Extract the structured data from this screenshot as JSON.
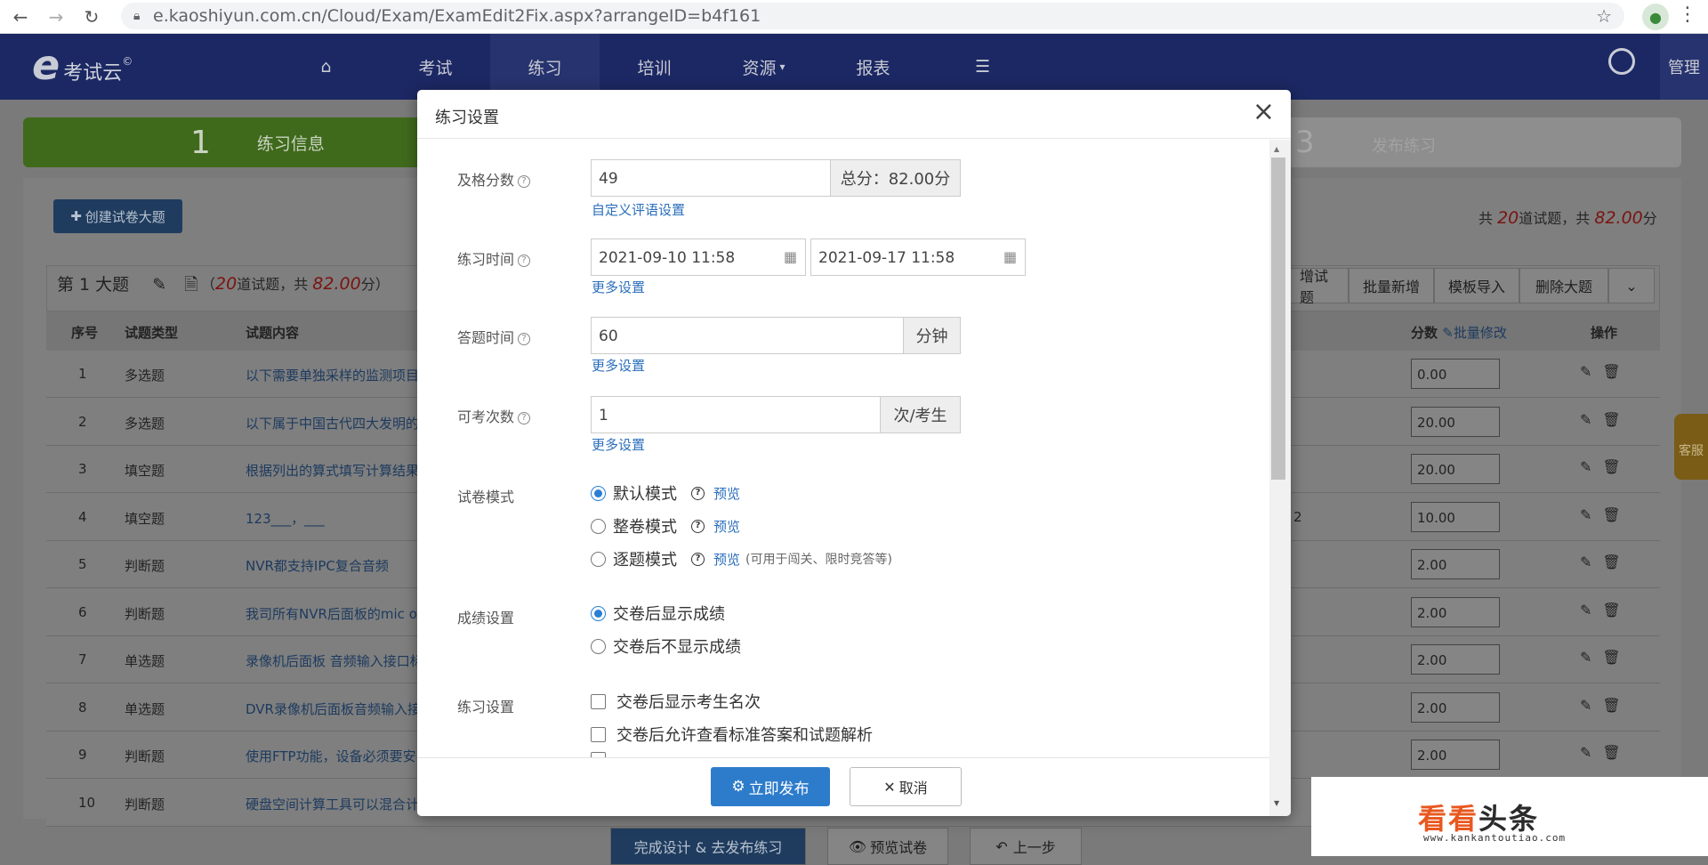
{
  "browser": {
    "url": "e.kaoshiyun.com.cn/Cloud/Exam/ExamEdit2Fix.aspx?arrangeID=b4f161"
  },
  "header": {
    "logo_text": "考试云",
    "logo_sup": "©",
    "nav": [
      "考试",
      "练习",
      "培训",
      "资源",
      "报表"
    ],
    "manage": "管理"
  },
  "steps": {
    "step1_num": "1",
    "step1_label": "练习信息",
    "step3_num": "3",
    "step3_label": "发布练习"
  },
  "toolbar": {
    "create_label": "创建试卷大题",
    "total_prefix": "共 ",
    "total_count": "20",
    "total_mid": "道试题，共 ",
    "total_score": "82.00",
    "total_suffix": "分"
  },
  "section": {
    "title": "第 1 大题",
    "info_prefix": "（",
    "info_count": "20",
    "info_mid": "道试题，共 ",
    "info_score": "82.00",
    "info_suffix": "分）",
    "buttons": [
      "增试题",
      "批量新增",
      "模板导入",
      "删除大题"
    ]
  },
  "table": {
    "headers": {
      "num": "序号",
      "type": "试题类型",
      "content": "试题内容",
      "score": "分数",
      "batch": "批量修改",
      "ops": "操作"
    },
    "rows": [
      {
        "num": "1",
        "type": "多选题",
        "content": "以下需要单独采样的监测项目",
        "extra": "",
        "score": "0.00"
      },
      {
        "num": "2",
        "type": "多选题",
        "content": "以下属于中国古代四大发明的",
        "extra": "",
        "score": "20.00"
      },
      {
        "num": "3",
        "type": "填空题",
        "content": "根据列出的算式填写计算结果",
        "extra": "",
        "score": "20.00"
      },
      {
        "num": "4",
        "type": "填空题",
        "content": "123___，___",
        "extra": "2",
        "score": "10.00"
      },
      {
        "num": "5",
        "type": "判断题",
        "content": "NVR都支持IPC复合音频",
        "extra": "",
        "score": "2.00"
      },
      {
        "num": "6",
        "type": "判断题",
        "content": "我司所有NVR后面板的mic o",
        "extra": "",
        "score": "2.00"
      },
      {
        "num": "7",
        "type": "单选题",
        "content": "录像机后面板 音频输入接口标",
        "extra": "",
        "score": "2.00"
      },
      {
        "num": "8",
        "type": "单选题",
        "content": "DVR录像机后面板音频输入接",
        "extra": "",
        "score": "2.00"
      },
      {
        "num": "9",
        "type": "判断题",
        "content": "使用FTP功能，设备必须要安",
        "extra": "",
        "score": "2.00"
      },
      {
        "num": "10",
        "type": "判断题",
        "content": "硬盘空间计算工具可以混合计",
        "extra": "",
        "score": ""
      }
    ]
  },
  "bottom": {
    "finish": "完成设计 & 去发布练习",
    "preview": "预览试卷",
    "back": "上一步"
  },
  "side": {
    "kefu": "客服"
  },
  "watermark": {
    "main1": "看看",
    "main2": "头条",
    "url": "www.kankantoutiao.com"
  },
  "modal": {
    "title": "练习设置",
    "pass_label": "及格分数",
    "pass_value": "49",
    "pass_addon": "总分：82.00分",
    "custom_eval": "自定义评语设置",
    "time_label": "练习时间",
    "start_time": "2021-09-10 11:58",
    "end_time": "2021-09-17 11:58",
    "more1": "更多设置",
    "answer_label": "答题时间",
    "answer_value": "60",
    "answer_addon": "分钟",
    "more2": "更多设置",
    "times_label": "可考次数",
    "times_value": "1",
    "times_addon": "次/考生",
    "more3": "更多设置",
    "mode_label": "试卷模式",
    "modes": [
      {
        "label": "默认模式",
        "preview": "预览",
        "note": ""
      },
      {
        "label": "整卷模式",
        "preview": "预览",
        "note": ""
      },
      {
        "label": "逐题模式",
        "preview": "预览",
        "note": "(可用于闯关、限时竞答等)"
      }
    ],
    "score_label": "成绩设置",
    "score_opts": [
      "交卷后显示成绩",
      "交卷后不显示成绩"
    ],
    "practice_label": "练习设置",
    "practice_opts": [
      "交卷后显示考生名次",
      "交卷后允许查看标准答案和试题解析"
    ],
    "publish": "立即发布",
    "cancel": "取消"
  }
}
